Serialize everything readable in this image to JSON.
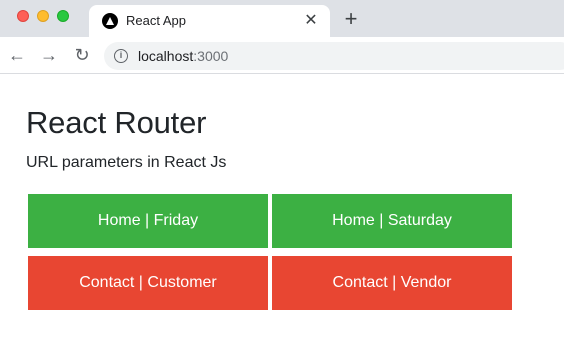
{
  "browser": {
    "tab": {
      "title": "React App",
      "close_icon": "close-icon",
      "favicon": "react-app-favicon"
    },
    "new_tab_symbol": "+",
    "nav": {
      "back_glyph": "←",
      "forward_glyph": "→",
      "reload_glyph": "↻"
    },
    "address": {
      "host": "localhost",
      "port": ":3000"
    }
  },
  "page": {
    "heading": "React Router",
    "subtitle": "URL parameters in React Js",
    "buttons": [
      {
        "label": "Home | Friday",
        "color": "#3cb043"
      },
      {
        "label": "Home | Saturday",
        "color": "#3cb043"
      },
      {
        "label": "Contact | Customer",
        "color": "#e84632"
      },
      {
        "label": "Contact | Vendor",
        "color": "#e84632"
      }
    ]
  }
}
